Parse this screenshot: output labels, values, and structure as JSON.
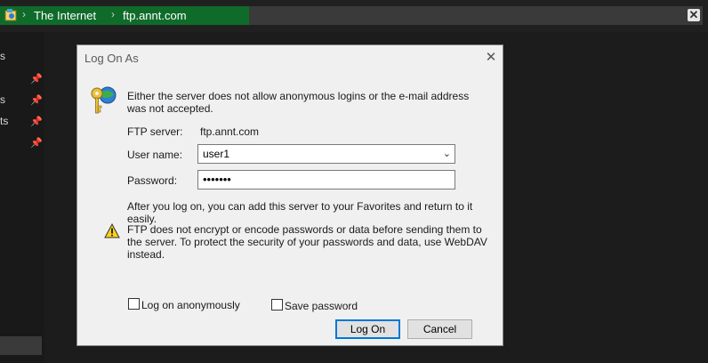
{
  "address_bar": {
    "crumb1": "The Internet",
    "crumb2": "ftp.annt.com",
    "separator": "›",
    "close_glyph": "✕",
    "accent": "#0f6b2a"
  },
  "sidebar": {
    "items": [
      {
        "label": "s",
        "pinned": false
      },
      {
        "label": "s",
        "pinned": true
      },
      {
        "label": "ts",
        "pinned": true
      },
      {
        "label": "",
        "pinned": true
      }
    ]
  },
  "dialog": {
    "title": "Log On As",
    "close_glyph": "✕",
    "message": "Either the server does not allow anonymous logins or the e-mail address was not accepted.",
    "ftp_server_label": "FTP server:",
    "ftp_server_value": "ftp.annt.com",
    "username_label": "User name:",
    "username_value": "user1",
    "password_label": "Password:",
    "password_value": "•••••••",
    "favorites_note": "After you log on, you can add this server to your Favorites and return to it easily.",
    "warning_text": "FTP does not encrypt or encode passwords or data before sending them to the server.  To protect the security of your passwords and data, use WebDAV instead.",
    "anonymous_label": "Log on anonymously",
    "anonymous_checked": false,
    "save_password_label": "Save password",
    "save_password_checked": false,
    "logon_button": "Log On",
    "cancel_button": "Cancel"
  }
}
